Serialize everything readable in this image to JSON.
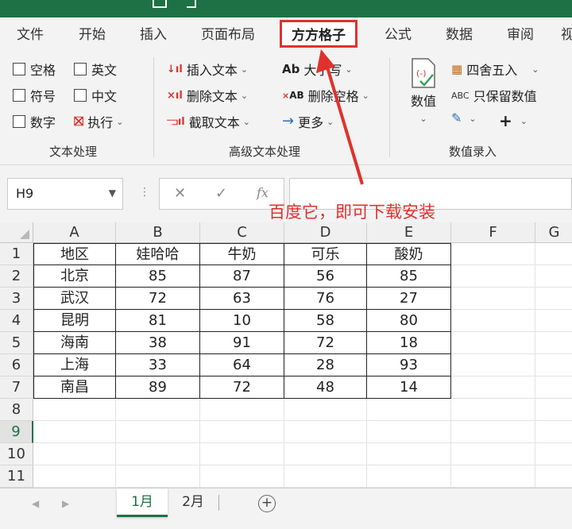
{
  "tabs": [
    "文件",
    "开始",
    "插入",
    "页面布局",
    "方方格子",
    "公式",
    "数据",
    "审阅",
    "视"
  ],
  "ribbon": {
    "text_group": {
      "checkboxes": [
        "空格",
        "英文",
        "符号",
        "中文",
        "数字"
      ],
      "exec": "执行",
      "label": "文本处理"
    },
    "adv_group": {
      "insert": "插入文本",
      "delete": "删除文本",
      "extract": "截取文本",
      "case": "大小写",
      "delete_space": "删除空格",
      "more": "更多",
      "case_icon": "Ab",
      "delspace_icon": "AB",
      "label": "高级文本处理"
    },
    "num_group": {
      "value_btn": "数值",
      "round": "四舍五入",
      "keep_value": "只保留数值",
      "abc_icon": "ABC",
      "plus": "+",
      "label": "数值录入"
    }
  },
  "formula_bar": {
    "name_box": "H9",
    "fx": "fx",
    "annotation": "百度它，即可下载安装"
  },
  "grid": {
    "columns": [
      "A",
      "B",
      "C",
      "D",
      "E",
      "F",
      "G"
    ],
    "rows": [
      "1",
      "2",
      "3",
      "4",
      "5",
      "6",
      "7",
      "8",
      "9",
      "10",
      "11"
    ],
    "table": [
      [
        "地区",
        "娃哈哈",
        "牛奶",
        "可乐",
        "酸奶"
      ],
      [
        "北京",
        "85",
        "87",
        "56",
        "85"
      ],
      [
        "武汉",
        "72",
        "63",
        "76",
        "27"
      ],
      [
        "昆明",
        "81",
        "10",
        "58",
        "80"
      ],
      [
        "海南",
        "38",
        "91",
        "72",
        "18"
      ],
      [
        "上海",
        "33",
        "64",
        "28",
        "93"
      ],
      [
        "南昌",
        "89",
        "72",
        "48",
        "14"
      ]
    ]
  },
  "sheets": [
    "1月",
    "2月"
  ],
  "colors": {
    "accent": "#1e7145",
    "highlight": "#e0312c"
  }
}
